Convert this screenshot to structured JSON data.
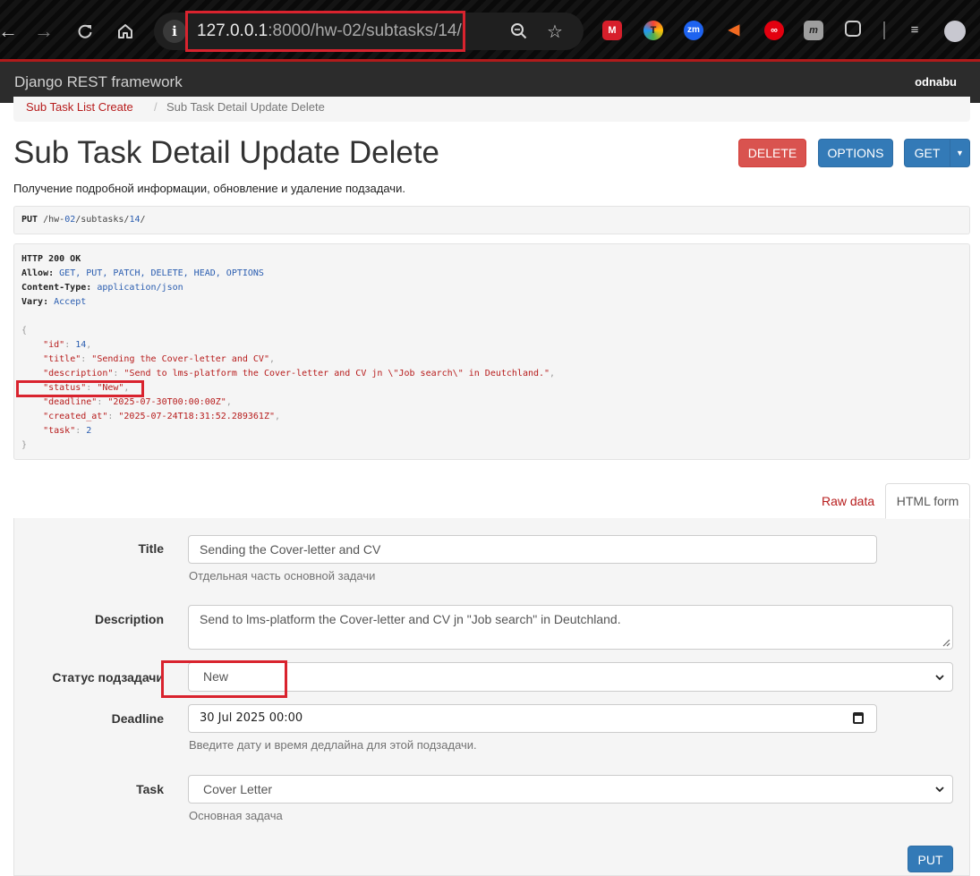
{
  "browser": {
    "url_host": "127.0.0.1",
    "url_rest": ":8000/hw-02/subtasks/14/",
    "extensions": [
      "mendeley-icon",
      "t-icon",
      "zm-icon",
      "megaphone-icon",
      "infinity-icon",
      "m-icon",
      "puzzle-icon"
    ]
  },
  "navbar": {
    "brand": "Django REST framework",
    "user": "odnabu"
  },
  "breadcrumb": {
    "parent": "Sub Task List Create",
    "separator": "/",
    "current": "Sub Task Detail Update Delete"
  },
  "page": {
    "title": "Sub Task Detail Update Delete",
    "description": "Получение подробной информации, обновление и удаление подзадачи."
  },
  "buttons": {
    "delete": "DELETE",
    "options": "OPTIONS",
    "get": "GET",
    "put": "PUT"
  },
  "request": {
    "method": "PUT",
    "p1": "/hw-",
    "p2": "02",
    "p3": "/subtasks/",
    "p4": "14",
    "p5": "/"
  },
  "response": {
    "status_line": "HTTP 200 OK",
    "allow_key": "Allow:",
    "allow_val": "GET, PUT, PATCH, DELETE, HEAD, OPTIONS",
    "ctype_key": "Content-Type:",
    "ctype_val": "application/json",
    "vary_key": "Vary:",
    "vary_val": "Accept",
    "open_brace": "{",
    "close_brace": "}",
    "fields": [
      {
        "key": "\"id\"",
        "value": "14",
        "type": "num"
      },
      {
        "key": "\"title\"",
        "value": "\"Sending the Cover-letter and CV\"",
        "type": "str"
      },
      {
        "key": "\"description\"",
        "value": "\"Send to lms-platform the Cover-letter and CV jn \\\"Job search\\\" in Deutchland.\"",
        "type": "str"
      },
      {
        "key": "\"status\"",
        "value": "\"New\"",
        "type": "str"
      },
      {
        "key": "\"deadline\"",
        "value": "\"2025-07-30T00:00:00Z\"",
        "type": "str"
      },
      {
        "key": "\"created_at\"",
        "value": "\"2025-07-24T18:31:52.289361Z\"",
        "type": "str"
      },
      {
        "key": "\"task\"",
        "value": "2",
        "type": "num"
      }
    ]
  },
  "tabs": {
    "raw": "Raw data",
    "html": "HTML form"
  },
  "form": {
    "title_label": "Title",
    "title_value": "Sending the Cover-letter and CV",
    "title_help": "Отдельная часть основной задачи",
    "description_label": "Description",
    "description_value": "Send to lms-platform the Cover-letter and CV jn \"Job search\" in Deutchland.",
    "status_label": "Статус подзадачи",
    "status_value": "New",
    "deadline_label": "Deadline",
    "deadline_value": "30 Jul 2025 00:00",
    "deadline_help": "Введите дату и время дедлайна для этой подзадачи.",
    "task_label": "Task",
    "task_value": "Cover Letter",
    "task_help": "Основная задача"
  },
  "colors": {
    "highlight": "#d9232e",
    "link": "#b71c1c",
    "primary": "#337ab7",
    "danger": "#d9534f"
  }
}
